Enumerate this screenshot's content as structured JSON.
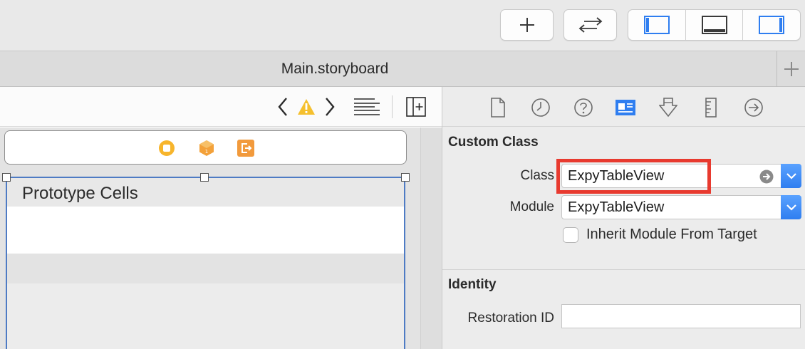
{
  "toolbar": {
    "add_icon": "plus-icon",
    "swap_icon": "swap-arrows-icon",
    "panel_toggles": [
      "navigator-panel-icon",
      "debug-area-icon",
      "utilities-panel-icon"
    ],
    "accent_color": "#2f7ef0"
  },
  "tab": {
    "title": "Main.storyboard",
    "new_tab_icon": "plus-icon"
  },
  "editor": {
    "jumpbar_icons": [
      "chevron-left-icon",
      "warning-icon",
      "chevron-right-icon",
      "lines-icon",
      "add-editor-icon"
    ],
    "scene_dock_icons": [
      "view-controller-icon",
      "first-responder-icon",
      "exit-icon"
    ],
    "table": {
      "header": "Prototype Cells"
    }
  },
  "inspector": {
    "tabs": [
      "file-icon",
      "history-icon",
      "help-icon",
      "identity-icon",
      "attributes-icon",
      "size-icon",
      "connections-icon"
    ],
    "active_tab": "identity-icon",
    "custom_class": {
      "title": "Custom Class",
      "class_label": "Class",
      "class_value": "ExpyTableView",
      "module_label": "Module",
      "module_value": "ExpyTableView",
      "inherit_label": "Inherit Module From Target",
      "inherit_checked": false
    },
    "identity": {
      "title": "Identity",
      "restoration_label": "Restoration ID",
      "restoration_value": ""
    },
    "highlight_color": "#e83a2f"
  }
}
